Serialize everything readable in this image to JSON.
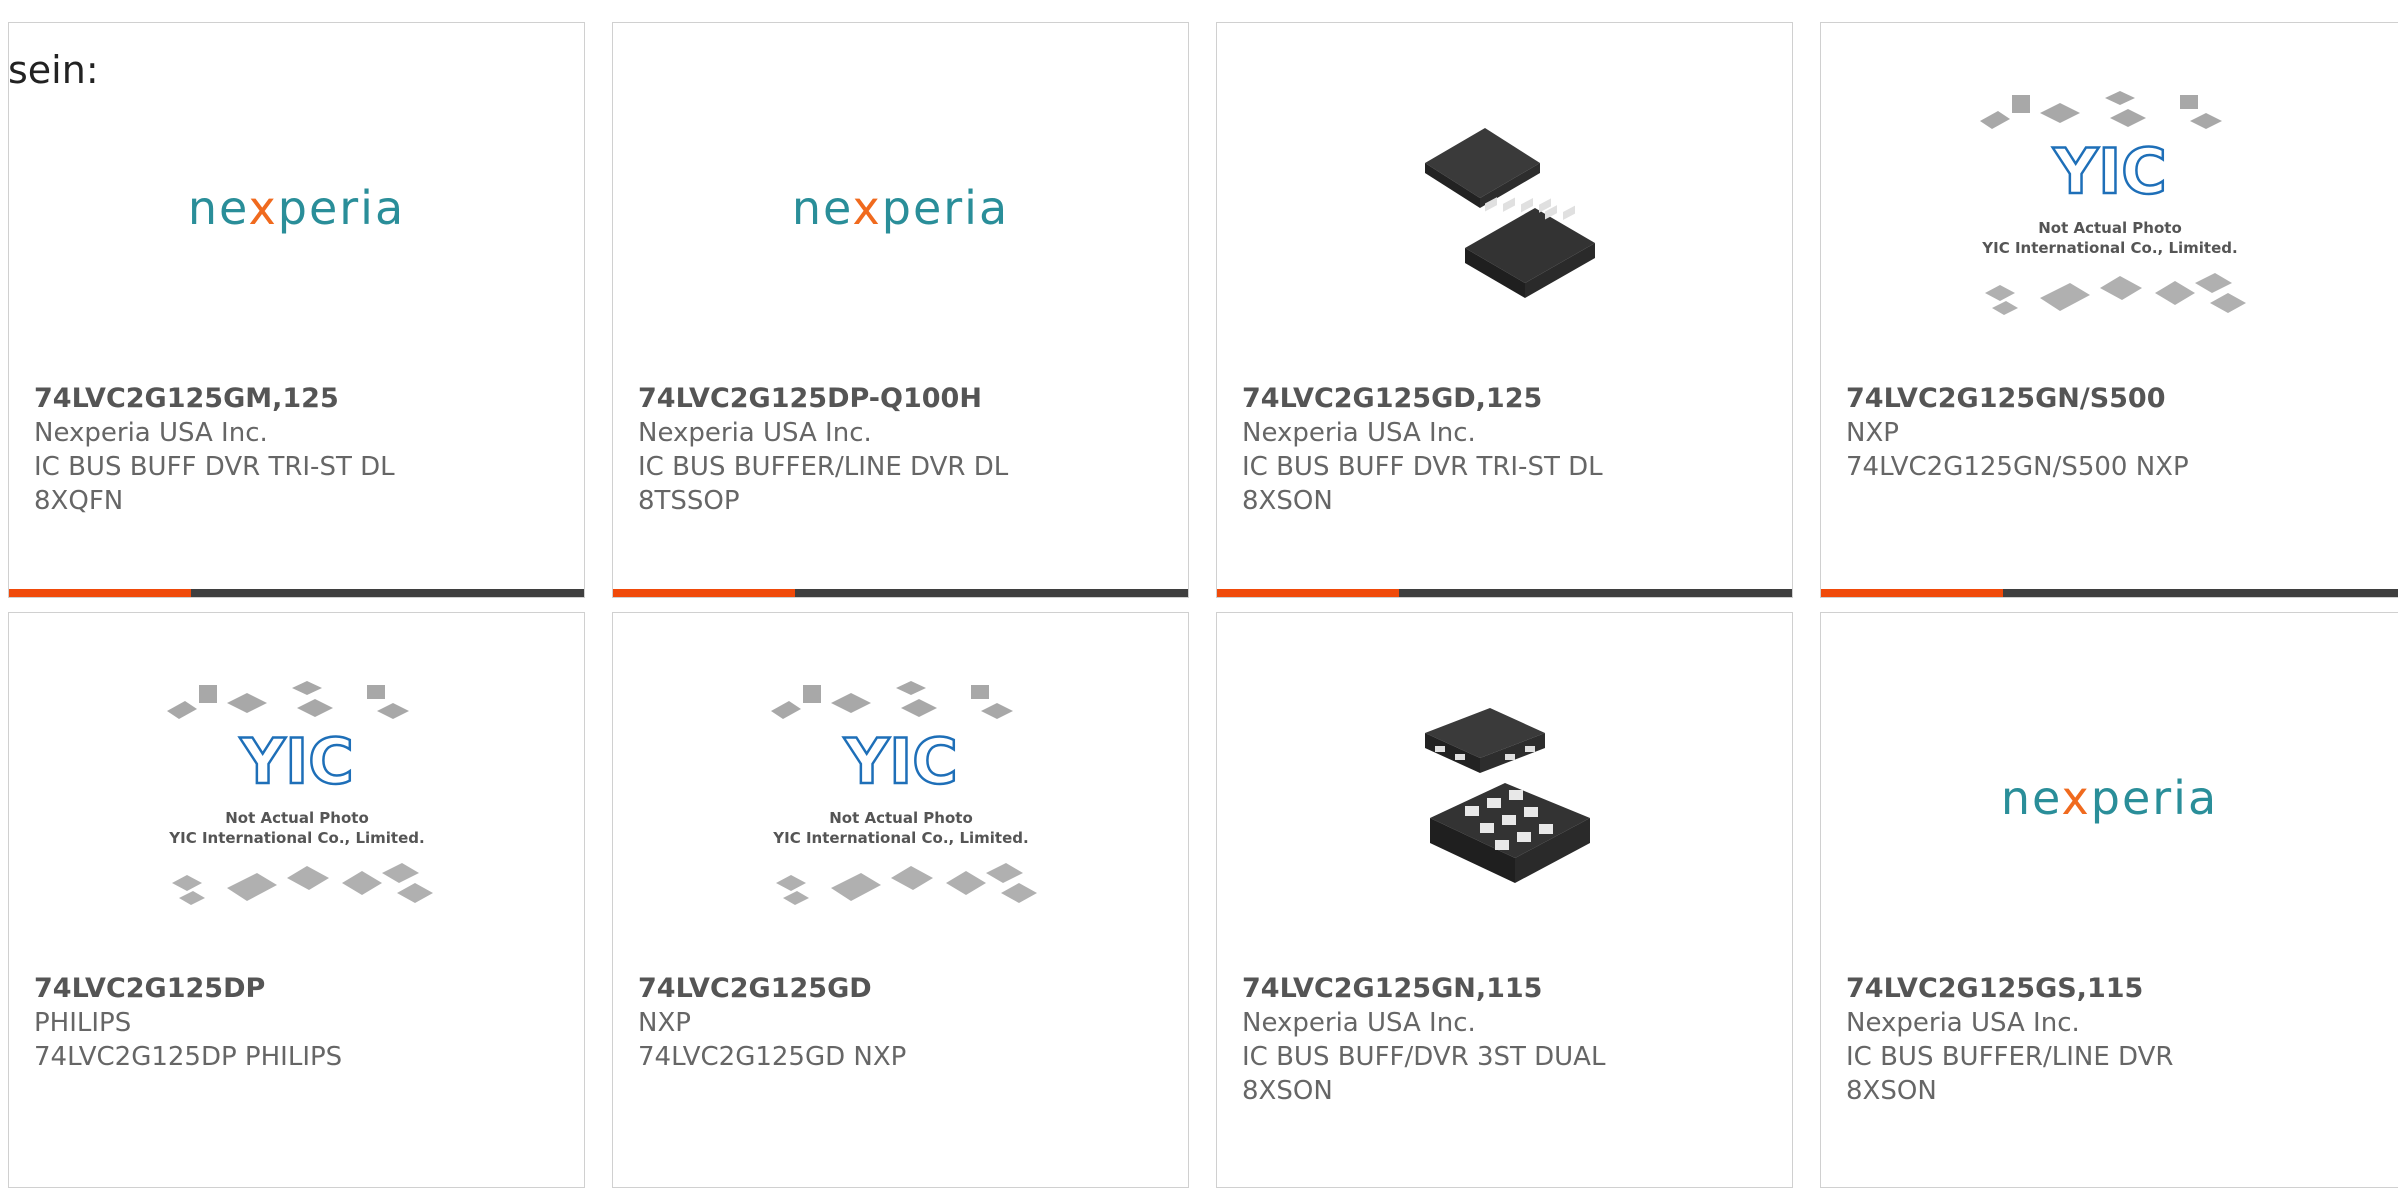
{
  "page": {
    "heading": "sein:"
  },
  "colors": {
    "accent": "#f04a0a",
    "bar": "#3f3f3f",
    "nexperia_teal": "#2a8e99",
    "nexperia_x": "#f06a1e",
    "yic_blue": "#1e6fb8"
  },
  "logos": {
    "nexperia_pre": "ne",
    "nexperia_x": "x",
    "nexperia_post": "peria",
    "yic_text": "YIC",
    "yic_line1": "Not Actual Photo",
    "yic_line2": "YIC International Co., Limited."
  },
  "products": [
    {
      "part": "74LVC2G125GM,125",
      "manufacturer": "Nexperia USA Inc.",
      "description": "IC BUS BUFF DVR TRI-ST DL 8XQFN",
      "image": "nexperia-logo"
    },
    {
      "part": "74LVC2G125DP-Q100H",
      "manufacturer": "Nexperia USA Inc.",
      "description": "IC BUS BUFFER/LINE DVR DL 8TSSOP",
      "image": "nexperia-logo"
    },
    {
      "part": "74LVC2G125GD,125",
      "manufacturer": "Nexperia USA Inc.",
      "description": "IC BUS BUFF DVR TRI-ST DL 8XSON",
      "image": "chip-xson-photo"
    },
    {
      "part": "74LVC2G125GN/S500",
      "manufacturer": "NXP",
      "description": "74LVC2G125GN/S500 NXP",
      "image": "yic-placeholder"
    },
    {
      "part": "74LVC2G125DP",
      "manufacturer": "PHILIPS",
      "description": "74LVC2G125DP PHILIPS",
      "image": "yic-placeholder"
    },
    {
      "part": "74LVC2G125GD",
      "manufacturer": "NXP",
      "description": "74LVC2G125GD NXP",
      "image": "yic-placeholder"
    },
    {
      "part": "74LVC2G125GN,115",
      "manufacturer": "Nexperia USA Inc.",
      "description": "IC BUS BUFF/DVR 3ST DUAL 8XSON",
      "image": "chip-xson-photo-2"
    },
    {
      "part": "74LVC2G125GS,115",
      "manufacturer": "Nexperia USA Inc.",
      "description": "IC BUS BUFFER/LINE DVR 8XSON",
      "image": "nexperia-logo"
    }
  ]
}
